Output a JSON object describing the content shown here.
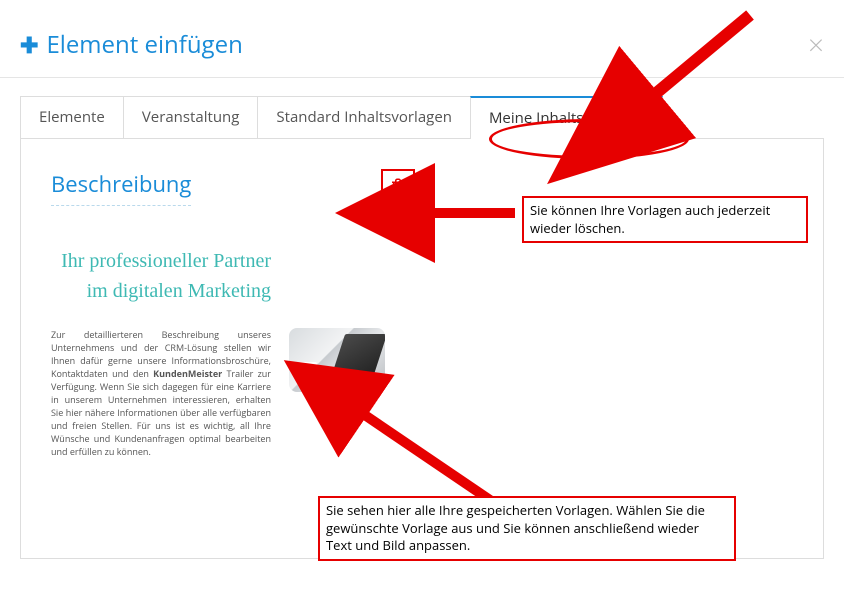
{
  "header": {
    "title": "Element einfügen",
    "close_label": "×"
  },
  "tabs": {
    "items": [
      {
        "label": "Elemente"
      },
      {
        "label": "Veranstaltung"
      },
      {
        "label": "Standard Inhaltsvorlagen"
      },
      {
        "label": "Meine Inhaltsvorlagen"
      }
    ],
    "active_index": 3
  },
  "template": {
    "name": "Beschreibung",
    "preview_heading": "Ihr professioneller Partner im digitalen Marketing",
    "preview_body_pre": "Zur detaillierteren Beschreibung unseres Unternehmens und der CRM-Lösung stellen wir Ihnen dafür gerne unsere Informationsbroschüre, Kontaktdaten und den ",
    "preview_body_bold": "KundenMeister",
    "preview_body_post": " Trailer zur Verfügung. Wenn Sie sich dagegen für eine Karriere in unserem Unternehmen interessieren, erhalten Sie hier nähere Informationen über alle verfügbaren und freien Stellen. Für uns ist es wichtig, all Ihre Wünsche und Kundenanfragen optimal bearbeiten und erfüllen zu können."
  },
  "annotations": {
    "delete_hint": "Sie können Ihre Vorlagen auch jederzeit wieder löschen.",
    "list_hint": "Sie sehen hier alle Ihre gespeicherten Vorlagen. Wählen Sie die gewünschte Vorlage aus und Sie können anschließend wieder Text und Bild anpassen."
  }
}
